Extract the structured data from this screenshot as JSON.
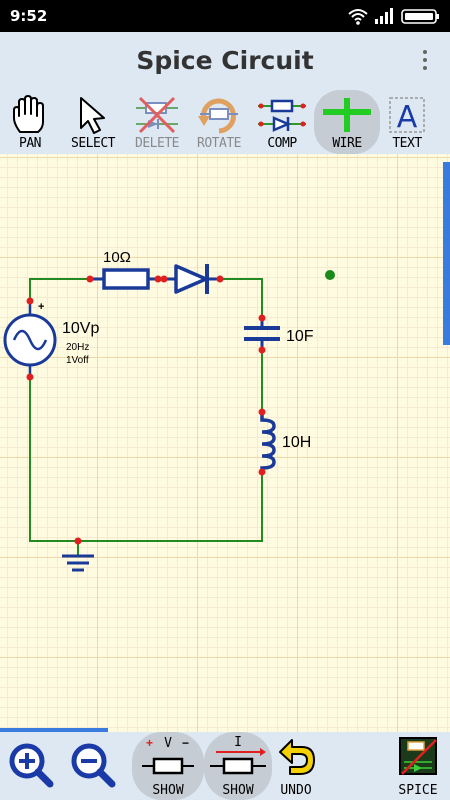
{
  "status": {
    "time": "9:52"
  },
  "app": {
    "title": "Spice Circuit"
  },
  "toolbar": {
    "pan": "PAN",
    "select": "SELECT",
    "delete": "DELETE",
    "rotate": "ROTATE",
    "comp": "COMP",
    "wire": "WIRE",
    "text": "TEXT",
    "active": "WIRE"
  },
  "circuit": {
    "resistor": "10Ω",
    "source_amp": "10Vp",
    "source_freq": "20Hz",
    "source_off": "1Voff",
    "capacitor": "10F",
    "inductor": "10H"
  },
  "bottombar": {
    "show_v": "SHOW",
    "show_i": "SHOW",
    "undo": "UNDO",
    "spice": "SPICE",
    "v_symbol": "V",
    "i_symbol": "I"
  },
  "colors": {
    "wire": "#228b22",
    "component": "#1a3a9a",
    "node": "#e0201e",
    "toolbar_bg": "#dde8f3",
    "grid_bg": "#fffbe0"
  }
}
